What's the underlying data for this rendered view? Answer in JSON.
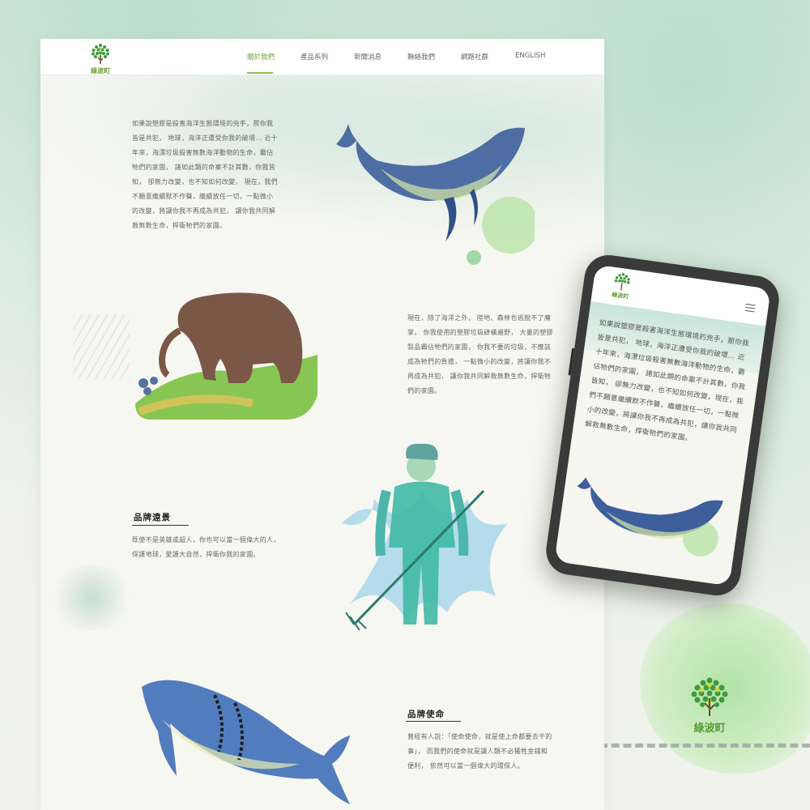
{
  "brand": {
    "name": "綠波町",
    "accent": "#6ea13c"
  },
  "nav": {
    "items": [
      {
        "label": "關於我們",
        "active": true
      },
      {
        "label": "產品系列"
      },
      {
        "label": "新聞消息"
      },
      {
        "label": "聯絡我們"
      },
      {
        "label": "網路社群"
      },
      {
        "label": "ENGLISH"
      }
    ]
  },
  "sections": {
    "intro": "如果說塑膠是殺害海洋生態環境的兇手，那你我皆是共犯， 地球，海洋正遭受你我的破壞… 近十年來，海漂垃圾殺害無數海洋動物的生命，霸佔牠們的家園， 諸如此類的命案不計其數，你我皆知， 卻無力改變，也不知如何改變， 現在，我們不願意繼續默不作聲，繼續放任一切，一點微小的改變，將讓你我不再成為共犯， 讓你我共同解救無數生命，捍衛牠們的家園。",
    "land": "現在，除了海洋之外， 陸地、森林也逃脫不了魔掌， 你我使用的塑膠垃圾肆橫遍野， 大量的塑膠製品霸佔牠們的家園， 你我不要的垃圾，不應該成為牠們的負擔， 一點微小的改變，將讓你我不再成為共犯， 讓你我共同解救無數生命，捍衛牠們的家園。",
    "vision_title": "品牌遠景",
    "vision_text": "既使不是英雄或超人，你也可以當一個偉大的人，保護地球，愛護大自然，捍衛你我的家園。",
    "mission_title": "品牌使命",
    "mission_text": "曾經有人說：「使命使命，就是使上命都要去干的事」， 而我們的使命就是讓人類不必犧牲金錢和便利， 依然可以當一個偉大的環保人。"
  },
  "phone": {
    "brand": "綠波町",
    "text": "如果說塑膠是殺害海洋生態環境的兇手，那你我皆是共犯， 地球，海洋正遭受你我的破壞… 近十年來，海漂垃圾殺害無數海洋動物的生命，霸佔牠們的家園， 諸如此類的命案不計其數，你我皆知， 卻無力改變，也不知如何改變，現在，我們不願意繼續默不作聲，繼續放任一切，一點微小的改變，將讓你我不再成為共犯，讓你我共同解救無數生命，捍衛牠們的家園。"
  },
  "icons": {
    "logo": "tree-logo-icon",
    "menu": "hamburger-menu-icon",
    "whale": "whale-illustration",
    "elephant": "elephant-illustration",
    "hero": "sea-god-illustration"
  }
}
